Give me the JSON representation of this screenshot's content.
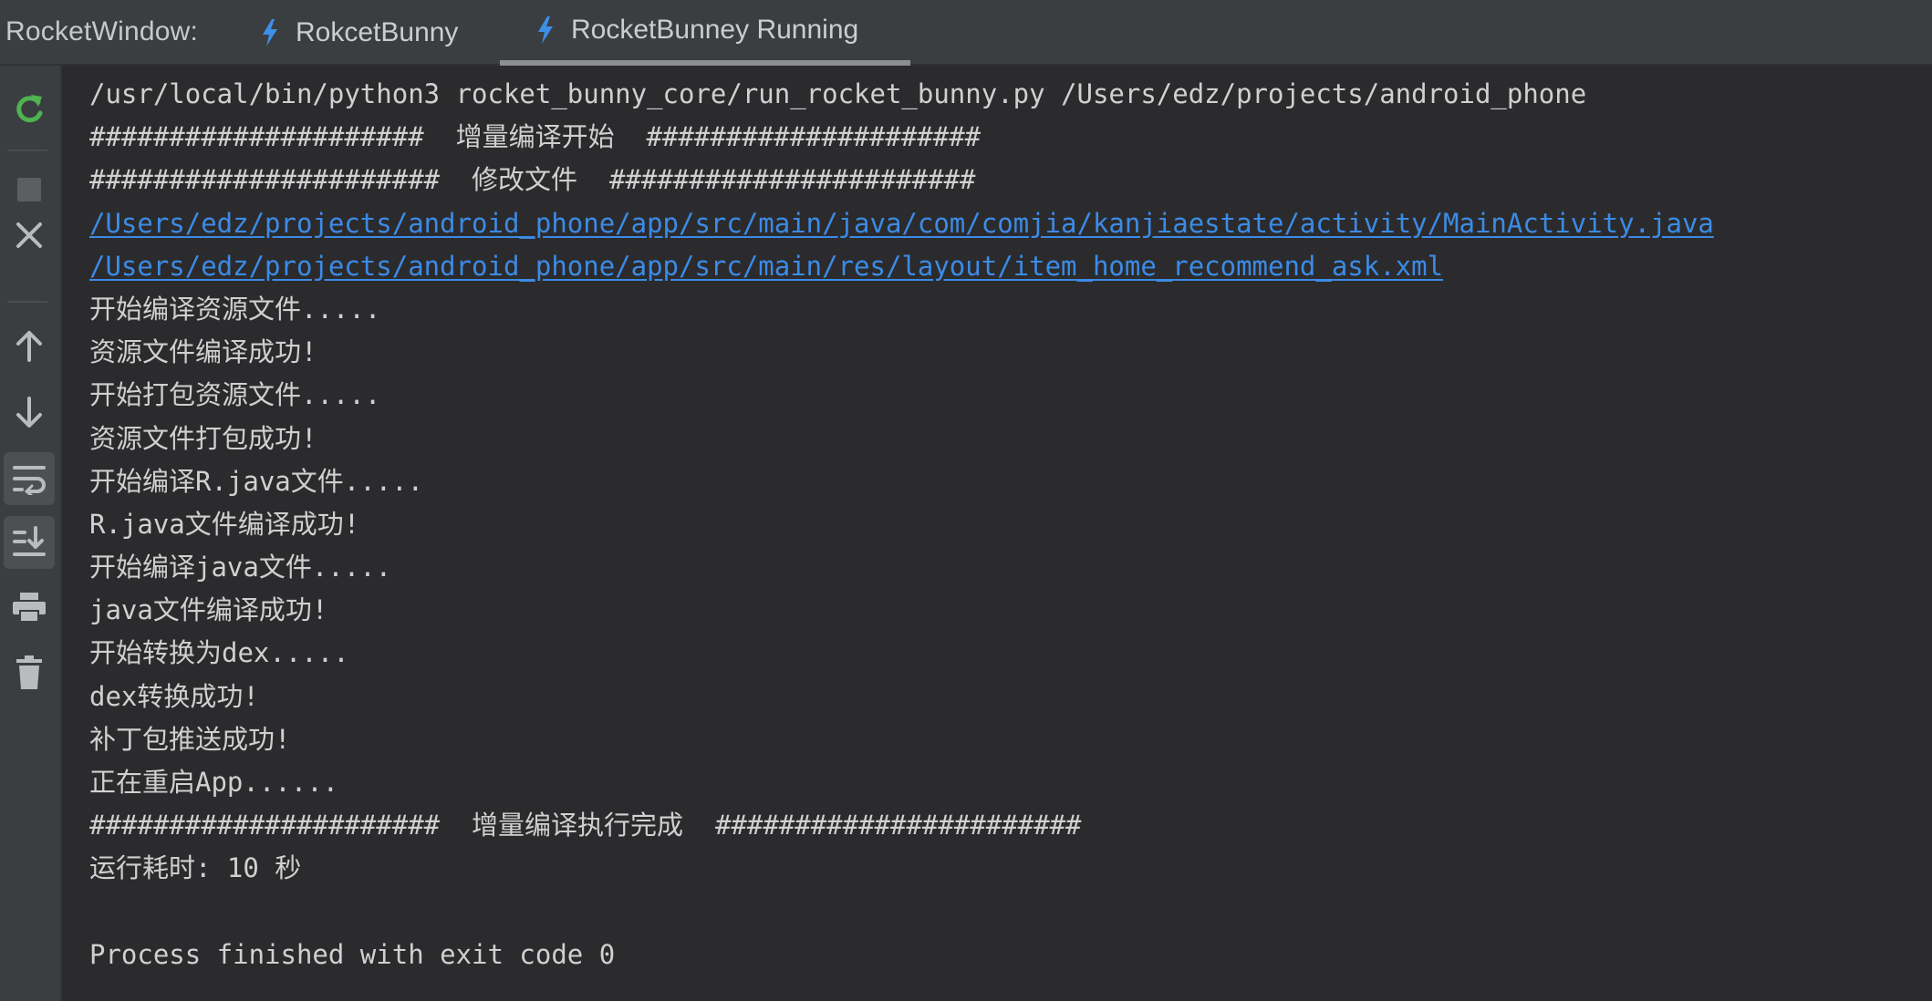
{
  "header": {
    "window_label": "RocketWindow:",
    "tabs": [
      {
        "label": "RokcetBunny",
        "icon": "lightning-icon",
        "active": false
      },
      {
        "label": "RocketBunney Running",
        "icon": "lightning-icon",
        "active": true
      }
    ]
  },
  "toolbar": {
    "items": [
      {
        "name": "rerun-icon",
        "active": false
      },
      {
        "name": "stop-icon",
        "active": false
      },
      {
        "name": "close-icon",
        "active": false
      },
      {
        "name": "arrow-up-icon",
        "active": false
      },
      {
        "name": "arrow-down-icon",
        "active": false
      },
      {
        "name": "soft-wrap-icon",
        "active": true
      },
      {
        "name": "scroll-to-end-icon",
        "active": true
      },
      {
        "name": "print-icon",
        "active": false
      },
      {
        "name": "trash-icon",
        "active": false
      }
    ]
  },
  "console": {
    "lines": [
      "/usr/local/bin/python3 rocket_bunny_core/run_rocket_bunny.py /Users/edz/projects/android_phone",
      "#####################  增量编译开始  #####################",
      "######################  修改文件  #######################",
      "/Users/edz/projects/android_phone/app/src/main/java/com/comjia/kanjiaestate/activity/MainActivity.java",
      "/Users/edz/projects/android_phone/app/src/main/res/layout/item_home_recommend_ask.xml",
      "开始编译资源文件.....",
      "资源文件编译成功!",
      "开始打包资源文件.....",
      "资源文件打包成功!",
      "开始编译R.java文件.....",
      "R.java文件编译成功!",
      "开始编译java文件.....",
      "java文件编译成功!",
      "开始转换为dex.....",
      "dex转换成功!",
      "补丁包推送成功!",
      "正在重启App......",
      "######################  增量编译执行完成  #######################",
      "运行耗时: 10 秒",
      "",
      "Process finished with exit code 0"
    ]
  },
  "colors": {
    "background": "#2b2b2d",
    "panel": "#3b3e40",
    "text": "#d0d0d0",
    "link": "#3c8be6",
    "rerun_green": "#4fb34f",
    "bolt_blue": "#3d8fe8"
  }
}
